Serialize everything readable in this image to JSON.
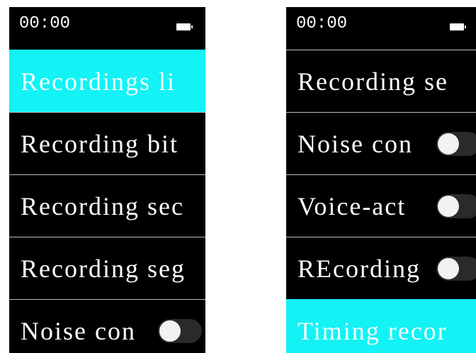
{
  "colors": {
    "screen_background": "#000000",
    "highlight": "#13f2f5",
    "divider": "#bdbdbd",
    "text": "#ffffff",
    "toggle_track": "#2a2a2a",
    "toggle_knob": "#f2f2f2"
  },
  "left_screen": {
    "status": {
      "time": "00:00",
      "battery_icon": "battery-icon"
    },
    "items": [
      {
        "label": "Recordings li",
        "selected": true
      },
      {
        "label": "Recording bit"
      },
      {
        "label": "Recording sec"
      },
      {
        "label": "Recording seg"
      },
      {
        "label": "Noise con",
        "toggle": {
          "state": "off",
          "icon": "toggle-switch-icon"
        }
      }
    ]
  },
  "right_screen": {
    "status": {
      "time": "00:00",
      "battery_icon": "battery-icon"
    },
    "items": [
      {
        "label": "Recording se"
      },
      {
        "label": "Noise con",
        "toggle": {
          "state": "off",
          "icon": "toggle-switch-icon"
        }
      },
      {
        "label": "Voice-act",
        "toggle": {
          "state": "off",
          "icon": "toggle-switch-icon"
        }
      },
      {
        "label": "REcording",
        "toggle": {
          "state": "off",
          "icon": "toggle-switch-icon"
        }
      },
      {
        "label": "Timing recor",
        "selected": true
      }
    ]
  }
}
